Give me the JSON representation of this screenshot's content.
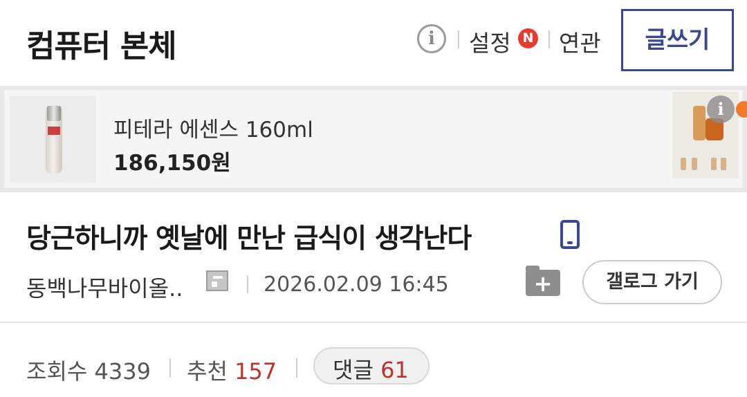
{
  "header": {
    "gallery_title": "컴퓨터 본체",
    "info_icon": "info-icon",
    "settings_label": "설정",
    "new_badge": "N",
    "related_label": "연관",
    "write_button": "글쓰기"
  },
  "ad": {
    "product_name": "피테라 에센스 160ml",
    "price": "186,150원",
    "info_icon": "info-icon"
  },
  "post": {
    "title": "당근하니까 옛날에 만난 급식이 생각난다",
    "device_icon": "mobile-icon",
    "author": "동백나무바이올..",
    "date": "2026.02.09 16:45",
    "folder_plus": "+",
    "gallog_button": "갤로그 가기"
  },
  "stats": {
    "views_label": "조회수",
    "views_value": "4339",
    "recommend_label": "추천",
    "recommend_value": "157",
    "comments_label": "댓글",
    "comments_value": "61"
  },
  "colors": {
    "brand_navy": "#3b4890",
    "badge_red": "#e83a2f",
    "count_red": "#c0302b"
  }
}
